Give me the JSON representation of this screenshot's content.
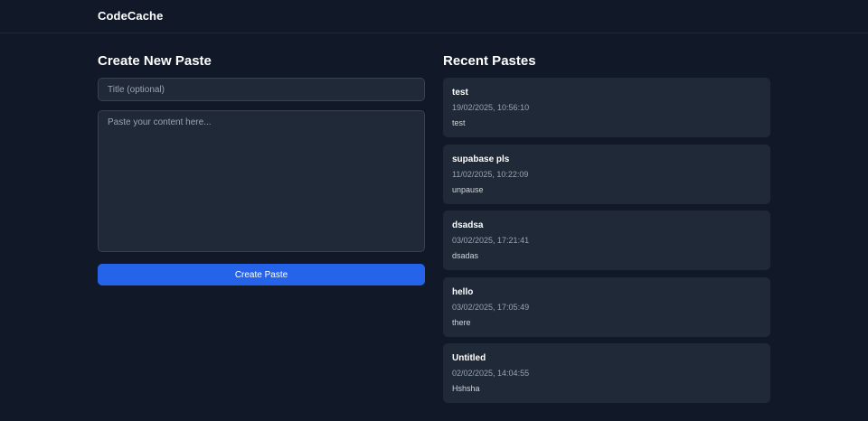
{
  "header": {
    "brand": "CodeCache"
  },
  "create": {
    "heading": "Create New Paste",
    "title_placeholder": "Title (optional)",
    "title_value": "",
    "content_placeholder": "Paste your content here...",
    "content_value": "",
    "submit_label": "Create Paste"
  },
  "recent": {
    "heading": "Recent Pastes",
    "items": [
      {
        "title": "test",
        "date": "19/02/2025, 10:56:10",
        "preview": "test"
      },
      {
        "title": "supabase pls",
        "date": "11/02/2025, 10:22:09",
        "preview": "unpause"
      },
      {
        "title": "dsadsa",
        "date": "03/02/2025, 17:21:41",
        "preview": "dsadas"
      },
      {
        "title": "hello",
        "date": "03/02/2025, 17:05:49",
        "preview": "there"
      },
      {
        "title": "Untitled",
        "date": "02/02/2025, 14:04:55",
        "preview": "Hshsha"
      }
    ]
  },
  "colors": {
    "background": "#111827",
    "surface": "#1f2937",
    "accent": "#2563eb"
  }
}
